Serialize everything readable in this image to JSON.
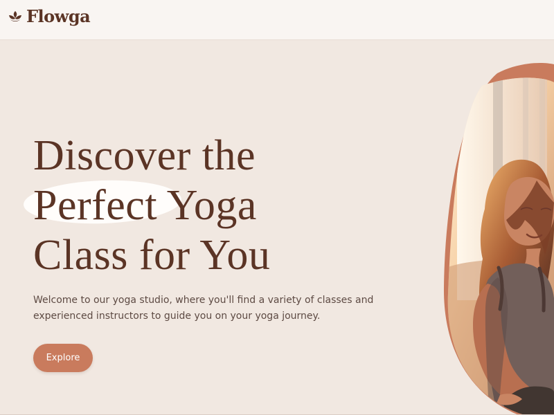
{
  "brand": {
    "name": "Flowga",
    "icon": "lotus-icon"
  },
  "hero": {
    "headline_line_1": "Discover the",
    "headline_highlight": "Perfect",
    "headline_line_2_rest": "Yoga",
    "headline_line_3": "Class for You",
    "description": "Welcome to our yoga studio, where you'll find a variety of classes and experienced instructors to guide you on your yoga journey.",
    "cta_label": "Explore"
  },
  "colors": {
    "brand_brown": "#5b3425",
    "accent_terracotta": "#c97b5d",
    "background_beige": "#f1e8e1",
    "highlight_white": "#fffdfb"
  }
}
